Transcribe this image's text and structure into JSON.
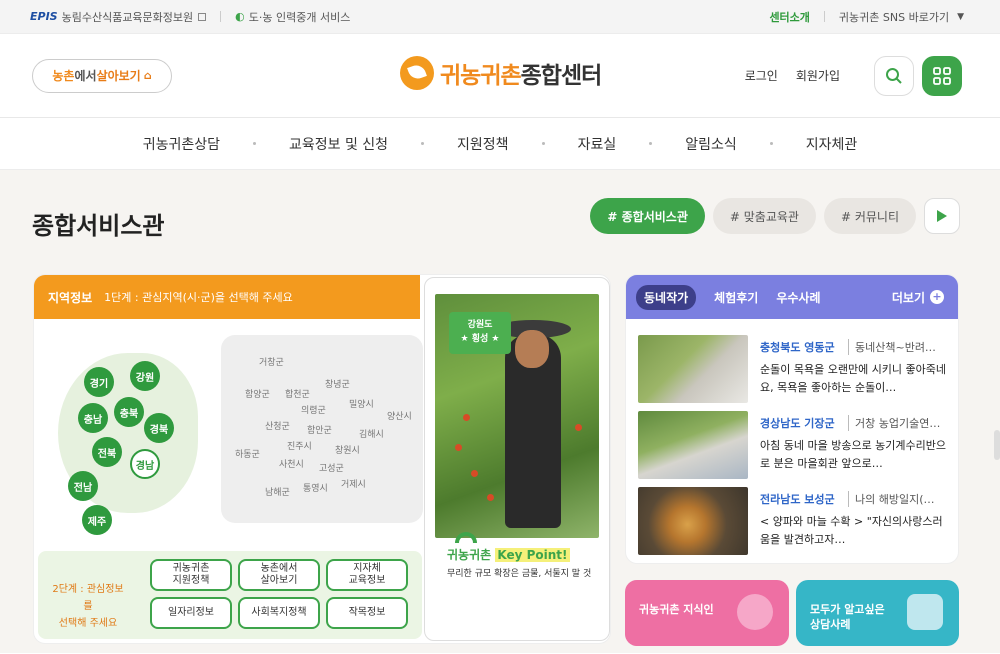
{
  "topbar": {
    "epis_logo": "EPIS",
    "org_name": "농림수산식품교육문화정보원",
    "service_name": "도·농 인력중개 서비스",
    "center_intro": "센터소개",
    "sns_link": "귀농귀촌 SNS 바로가기"
  },
  "header": {
    "live_button": {
      "part1": "농촌",
      "part2": "에서 ",
      "part3": "살아보기"
    },
    "logo": {
      "part1": "귀농귀촌",
      "part2": "종합센터"
    },
    "login": "로그인",
    "signup": "회원가입"
  },
  "gnb": [
    "귀농귀촌상담",
    "교육정보 및 신청",
    "지원정책",
    "자료실",
    "알림소식",
    "지자체관"
  ],
  "section": {
    "title": "종합서비스관",
    "tabs": [
      "# 종합서비스관",
      "# 맞춤교육관",
      "# 커뮤니티"
    ]
  },
  "region_card": {
    "head_title": "지역정보",
    "head_step": "1단계 : 관심지역(시·군)을 선택해 주세요",
    "regions": [
      "경기",
      "강원",
      "충남",
      "충북",
      "경북",
      "전북",
      "경남",
      "전남",
      "제주"
    ],
    "towns": [
      "거창군",
      "함양군",
      "합천군",
      "창녕군",
      "의령군",
      "밀양시",
      "산청군",
      "함안군",
      "김해시",
      "양산시",
      "진주시",
      "창원시",
      "하동군",
      "사천시",
      "고성군",
      "남해군",
      "통영시",
      "거제시"
    ],
    "step2_label": "2단계 : 관심정보를\n선택해 주세요",
    "options": [
      "귀농귀촌\n지원정책",
      "농촌에서\n살아보기",
      "지자체\n교육정보",
      "일자리정보",
      "사회복지정책",
      "작목정보"
    ]
  },
  "promo": {
    "badge_region": "강원도",
    "badge_city": "★ 횡성 ★",
    "kp_prefix": "귀농귀촌",
    "kp_highlight": "Key Point!",
    "kp_sub": "무리한 규모 확장은 금물, 서둘지 말 것"
  },
  "side_card": {
    "tabs": [
      "동네작가",
      "체험후기",
      "우수사례"
    ],
    "more": "더보기",
    "news": [
      {
        "region": "충청북도 영동군",
        "category": "동네산책~반려…",
        "text": "순돌이 목욕을 오랜만에 시키니 좋아죽네요, 목욕을 좋아하는 순돌이…"
      },
      {
        "region": "경상남도 기장군",
        "category": "거창 농업기술연…",
        "text": "아침 동네 마을 방송으로 농기계수리반으로 분은 마을회관 앞으로…"
      },
      {
        "region": "전라남도 보성군",
        "category": "나의 해방일지(…",
        "text": "< 양파와 마늘 수확 > \"자신의사랑스러움을 발견하고자…"
      }
    ]
  },
  "bottom_cards": {
    "pink": "귀농귀촌 지식인",
    "teal": "모두가 알고싶은\n상담사례"
  }
}
